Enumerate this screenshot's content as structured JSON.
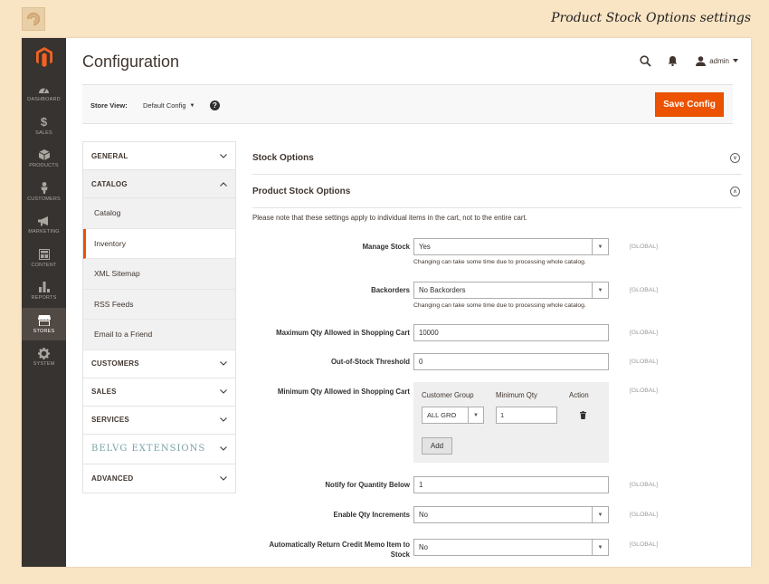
{
  "frame": {
    "caption": "Product Stock Options settings"
  },
  "sidebar": {
    "items": [
      {
        "label": "DASHBOARD",
        "icon": "dashboard-icon"
      },
      {
        "label": "SALES",
        "icon": "dollar-icon"
      },
      {
        "label": "PRODUCTS",
        "icon": "box-icon"
      },
      {
        "label": "CUSTOMERS",
        "icon": "person-icon"
      },
      {
        "label": "MARKETING",
        "icon": "megaphone-icon"
      },
      {
        "label": "CONTENT",
        "icon": "layout-icon"
      },
      {
        "label": "REPORTS",
        "icon": "bar-chart-icon"
      },
      {
        "label": "STORES",
        "icon": "store-icon",
        "active": true
      },
      {
        "label": "SYSTEM",
        "icon": "gear-icon"
      }
    ]
  },
  "header": {
    "title": "Configuration",
    "user": "admin"
  },
  "store_bar": {
    "label": "Store View:",
    "value": "Default Config",
    "help": "?",
    "save_label": "Save Config"
  },
  "config_nav": {
    "general": "GENERAL",
    "catalog": "CATALOG",
    "catalog_items": [
      "Catalog",
      "Inventory",
      "XML Sitemap",
      "RSS Feeds",
      "Email to a Friend"
    ],
    "customers": "CUSTOMERS",
    "sales": "SALES",
    "services": "SERVICES",
    "belvg": "BELVG EXTENSIONS",
    "advanced": "ADVANCED"
  },
  "content": {
    "stock_options_title": "Stock Options",
    "product_stock_title": "Product Stock Options",
    "note": "Please note that these settings apply to individual items in the cart, not to the entire cart.",
    "fields": {
      "manage_stock": {
        "label": "Manage Stock",
        "value": "Yes",
        "hint": "Changing can take some time due to processing whole catalog.",
        "scope": "[GLOBAL]"
      },
      "backorders": {
        "label": "Backorders",
        "value": "No Backorders",
        "hint": "Changing can take some time due to processing whole catalog.",
        "scope": "[GLOBAL]"
      },
      "max_qty": {
        "label": "Maximum Qty Allowed in Shopping Cart",
        "value": "10000",
        "scope": "[GLOBAL]"
      },
      "oos_threshold": {
        "label": "Out-of-Stock Threshold",
        "value": "0",
        "scope": "[GLOBAL]"
      },
      "min_qty": {
        "label": "Minimum Qty Allowed in Shopping Cart",
        "scope": "[GLOBAL]",
        "col_group": "Customer Group",
        "col_qty": "Minimum Qty",
        "col_action": "Action",
        "group_value": "ALL GRO",
        "qty_value": "1",
        "add_label": "Add"
      },
      "notify_qty": {
        "label": "Notify for Quantity Below",
        "value": "1",
        "scope": "[GLOBAL]"
      },
      "qty_increments": {
        "label": "Enable Qty Increments",
        "value": "No",
        "scope": "[GLOBAL]"
      },
      "auto_return": {
        "label": "Automatically Return Credit Memo Item to Stock",
        "value": "No",
        "scope": "[GLOBAL]"
      }
    }
  },
  "colors": {
    "accent": "#eb5202",
    "sidebar_bg": "#373330",
    "sidebar_active": "#514943",
    "frame_bg": "#f9e4c4"
  }
}
